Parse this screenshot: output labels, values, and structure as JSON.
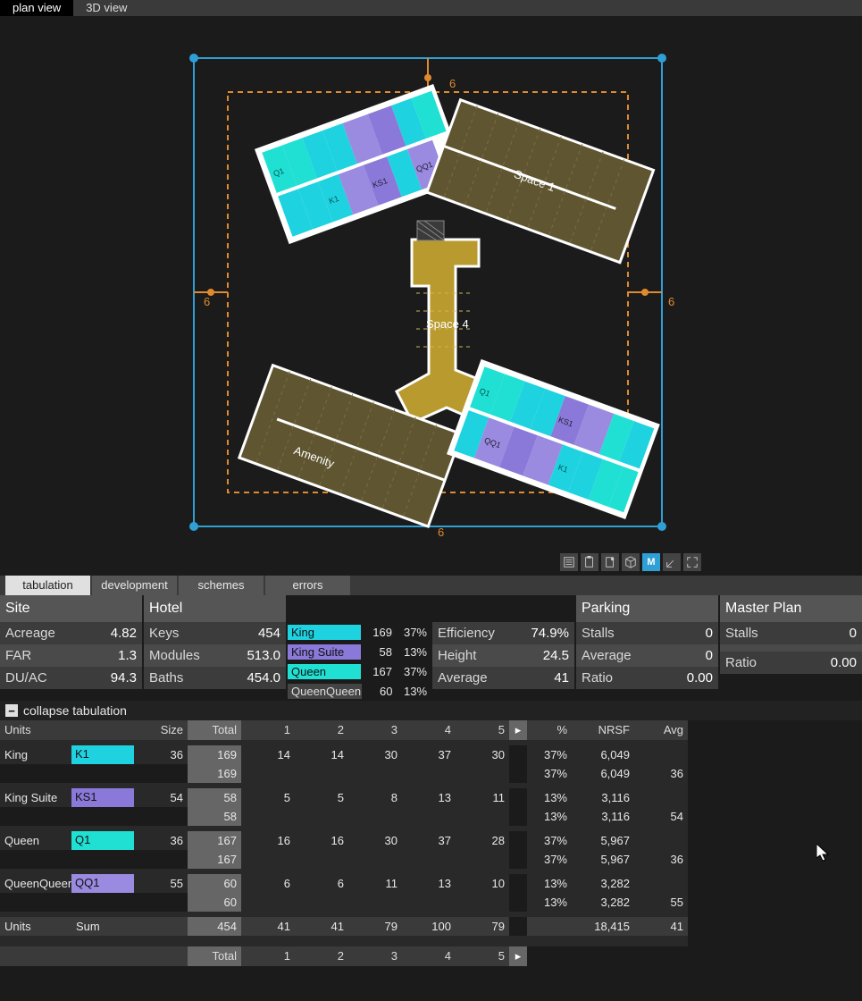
{
  "top_tabs": {
    "plan": "plan view",
    "threeD": "3D view",
    "active": "plan"
  },
  "viewport": {
    "setback_labels": [
      "6",
      "6",
      "6",
      "6"
    ],
    "spaces": {
      "s1": "Space 1",
      "s4": "Space 4",
      "amenity": "Amenity"
    },
    "unit_labels": [
      "Q1",
      "K1",
      "KS1",
      "QQ1"
    ]
  },
  "vp_toolbar_active": "M",
  "lower_tabs": {
    "items": [
      "tabulation",
      "development",
      "schemes",
      "errors"
    ],
    "active": "tabulation"
  },
  "summary": {
    "site": {
      "title": "Site",
      "rows": [
        [
          "Acreage",
          "4.82"
        ],
        [
          "FAR",
          "1.3"
        ],
        [
          "DU/AC",
          "94.3"
        ]
      ]
    },
    "hotel": {
      "title": "Hotel",
      "rows": [
        [
          "Keys",
          "454"
        ],
        [
          "Modules",
          "513.0"
        ],
        [
          "Baths",
          "454.0"
        ]
      ]
    },
    "mix": [
      {
        "name": "King",
        "count": "169",
        "pct": "37%",
        "color": "#1fd2e0"
      },
      {
        "name": "King Suite",
        "count": "58",
        "pct": "13%",
        "color": "#8a79d9"
      },
      {
        "name": "Queen",
        "count": "167",
        "pct": "37%",
        "color": "#1fe0d2"
      },
      {
        "name": "QueenQueen",
        "count": "60",
        "pct": "13%",
        "color": "#444"
      }
    ],
    "metrics": {
      "rows": [
        [
          "Efficiency",
          "74.9%"
        ],
        [
          "Height",
          "24.5"
        ],
        [
          "Average",
          "41"
        ]
      ]
    },
    "parking": {
      "title": "Parking",
      "rows": [
        [
          "Stalls",
          "0"
        ],
        [
          "Average",
          "0"
        ],
        [
          "Ratio",
          "0.00"
        ]
      ]
    },
    "master": {
      "title": "Master Plan",
      "rows": [
        [
          "Stalls",
          "0"
        ],
        [
          "",
          ""
        ],
        [
          "Ratio",
          "0.00"
        ]
      ]
    }
  },
  "collapse": {
    "label": "collapse tabulation"
  },
  "tabulation": {
    "headers": {
      "units": "Units",
      "size": "Size",
      "total": "Total",
      "cols": [
        "1",
        "2",
        "3",
        "4",
        "5"
      ],
      "pct": "%",
      "nrsf": "NRSF",
      "avg": "Avg"
    },
    "groups": [
      {
        "name": "King",
        "code": "K1",
        "color": "#1fd2e0",
        "size": "36",
        "total": "169",
        "cols": [
          "14",
          "14",
          "30",
          "37",
          "30"
        ],
        "pct": "37%",
        "nrsf": "6,049",
        "avg": "",
        "subtotal": {
          "total": "169",
          "pct": "37%",
          "nrsf": "6,049",
          "avg": "36"
        }
      },
      {
        "name": "King Suite",
        "code": "KS1",
        "color": "#8a79d9",
        "size": "54",
        "total": "58",
        "cols": [
          "5",
          "5",
          "8",
          "13",
          "11"
        ],
        "pct": "13%",
        "nrsf": "3,116",
        "avg": "",
        "subtotal": {
          "total": "58",
          "pct": "13%",
          "nrsf": "3,116",
          "avg": "54"
        }
      },
      {
        "name": "Queen",
        "code": "Q1",
        "color": "#1fe0d2",
        "size": "36",
        "total": "167",
        "cols": [
          "16",
          "16",
          "30",
          "37",
          "28"
        ],
        "pct": "37%",
        "nrsf": "5,967",
        "avg": "",
        "subtotal": {
          "total": "167",
          "pct": "37%",
          "nrsf": "5,967",
          "avg": "36"
        }
      },
      {
        "name": "QueenQueen",
        "code": "QQ1",
        "color": "#9a8ae0",
        "size": "55",
        "total": "60",
        "cols": [
          "6",
          "6",
          "11",
          "13",
          "10"
        ],
        "pct": "13%",
        "nrsf": "3,282",
        "avg": "",
        "subtotal": {
          "total": "60",
          "pct": "13%",
          "nrsf": "3,282",
          "avg": "55"
        }
      }
    ],
    "footer": {
      "label": "Units",
      "sub": "Sum",
      "total": "454",
      "cols": [
        "41",
        "41",
        "79",
        "100",
        "79"
      ],
      "nrsf": "18,415",
      "avg": "41"
    },
    "bottom_headers": {
      "total": "Total",
      "cols": [
        "1",
        "2",
        "3",
        "4",
        "5"
      ]
    }
  }
}
